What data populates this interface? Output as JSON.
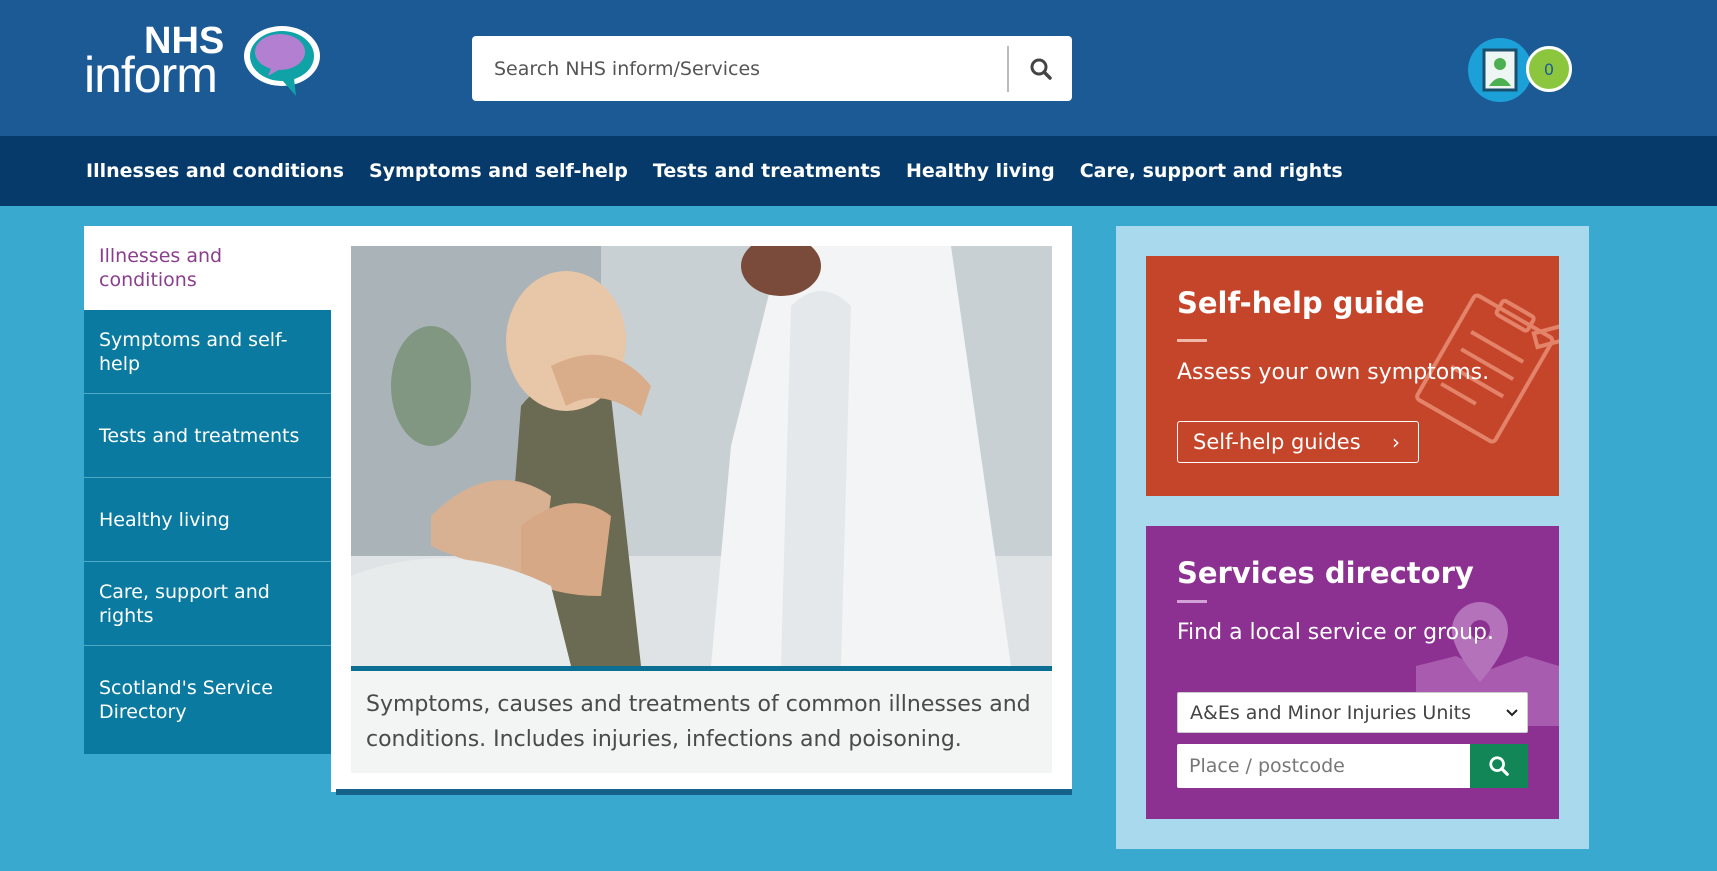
{
  "header": {
    "logo_top": "NHS",
    "logo_bottom": "inform",
    "search_placeholder": "Search NHS inform/Services",
    "badge_count": "0"
  },
  "nav": {
    "items": [
      {
        "label": "Illnesses and conditions"
      },
      {
        "label": "Symptoms and self-help"
      },
      {
        "label": "Tests and treatments"
      },
      {
        "label": "Healthy living"
      },
      {
        "label": "Care, support and rights"
      }
    ]
  },
  "sidebar": {
    "items": [
      {
        "label": "Illnesses and conditions",
        "active": true
      },
      {
        "label": "Symptoms and self-help"
      },
      {
        "label": "Tests and treatments"
      },
      {
        "label": "Healthy living"
      },
      {
        "label": "Care, support and rights"
      },
      {
        "label": "Scotland's Service Directory"
      }
    ]
  },
  "feature": {
    "caption": "Symptoms, causes and treatments of common illnesses and conditions. Includes injuries, infections and poisoning."
  },
  "self_help": {
    "title": "Self-help guide",
    "subtitle": "Assess your own symptoms.",
    "button_label": "Self-help guides",
    "color": "#c5452b"
  },
  "services": {
    "title": "Services directory",
    "subtitle": "Find a local service or group.",
    "selected_service": "A&Es and Minor Injuries Units",
    "postcode_placeholder": "Place / postcode",
    "color": "#8c3191"
  },
  "icons": {
    "search": "search-icon",
    "profile": "profile-icon",
    "chevron": "chevron-right-icon",
    "clipboard": "clipboard-icon",
    "map_pin": "map-pin-icon"
  }
}
